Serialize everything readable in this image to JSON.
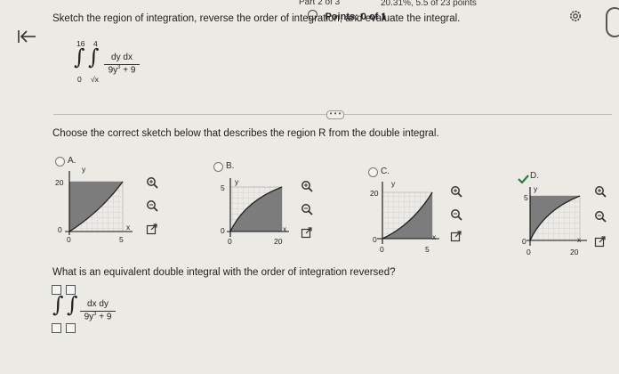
{
  "header": {
    "part": "Part 2 of 3",
    "score": "20.31%, 5.5 of 23 points",
    "points": "Points: 0 of 1",
    "settings_icon": "gear-icon",
    "back_icon": "arrow-left-bar-icon"
  },
  "question": {
    "prompt": "Sketch the region of integration, reverse the order of integration, and evaluate the integral.",
    "integral": {
      "outer_upper": "16",
      "outer_lower": "0",
      "inner_upper": "4",
      "inner_lower": "√x",
      "numerator": "dy dx",
      "denominator_base": "9y",
      "denominator_exp": "3",
      "denominator_rest": " + 9"
    },
    "more_label": "• • •"
  },
  "choose": {
    "prompt": "Choose the correct sketch below that describes the region R from the double integral.",
    "options": [
      {
        "letter": "A.",
        "y_top": "20",
        "y_zero": "0",
        "x_zero": "0",
        "x_right": "5",
        "x_axis": "x",
        "y_axis": "y",
        "selected": false
      },
      {
        "letter": "B.",
        "y_top": "5",
        "y_zero": "0",
        "x_zero": "0",
        "x_right": "20",
        "x_axis": "x",
        "y_axis": "y",
        "selected": false
      },
      {
        "letter": "C.",
        "y_top": "20",
        "y_zero": "0",
        "x_zero": "0",
        "x_right": "5",
        "x_axis": "x",
        "y_axis": "y",
        "selected": false
      },
      {
        "letter": "D.",
        "y_top": "5",
        "y_zero": "0",
        "x_zero": "0",
        "x_right": "20",
        "x_axis": "x",
        "y_axis": "y",
        "selected": true
      }
    ],
    "option_icons": [
      "zoom-in-icon",
      "zoom-out-icon",
      "popout-icon"
    ],
    "selected_color": "#2f7d32"
  },
  "reverse": {
    "prompt": "What is an equivalent double integral with the order of integration reversed?",
    "numerator": "dx dy",
    "denominator_base": "9y",
    "denominator_exp": "3",
    "denominator_rest": " + 9"
  }
}
